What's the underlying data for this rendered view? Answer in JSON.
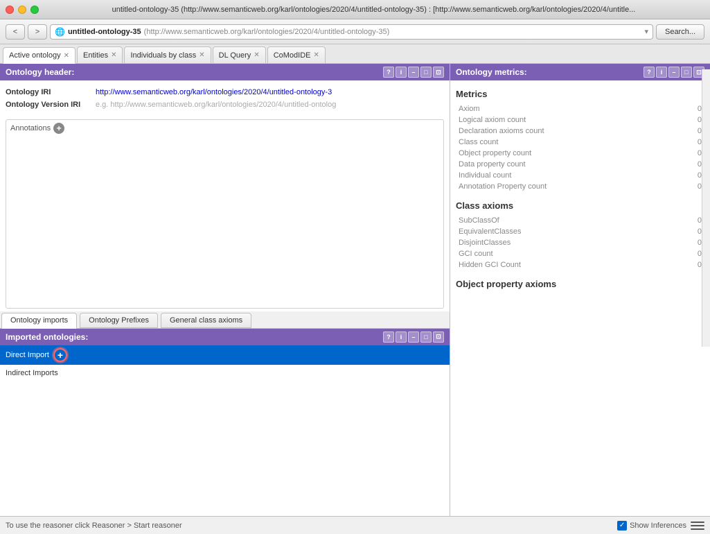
{
  "titlebar": {
    "title": "untitled-ontology-35 (http://www.semanticweb.org/karl/ontologies/2020/4/untitled-ontology-35) : [http://www.semanticweb.org/karl/ontologies/2020/4/untitle..."
  },
  "navbar": {
    "back": "<",
    "forward": ">",
    "url_bold": "untitled-ontology-35",
    "url_light": "(http://www.semanticweb.org/karl/ontologies/2020/4/untitled-ontology-35)",
    "search_placeholder": "Search..."
  },
  "tabs": [
    {
      "label": "Active ontology",
      "closable": true
    },
    {
      "label": "Entities",
      "closable": true
    },
    {
      "label": "Individuals by class",
      "closable": true
    },
    {
      "label": "DL Query",
      "closable": true
    },
    {
      "label": "CoModIDE",
      "closable": true
    }
  ],
  "ontology_header": {
    "title": "Ontology header:",
    "iri_label": "Ontology IRI",
    "iri_value": "http://www.semanticweb.org/karl/ontologies/2020/4/untitled-ontology-3",
    "version_label": "Ontology Version IRI",
    "version_placeholder": "e.g. http://www.semanticweb.org/karl/ontologies/2020/4/untitled-ontolog",
    "annotations_label": "Annotations"
  },
  "bottom_tabs": [
    {
      "label": "Ontology imports",
      "active": true
    },
    {
      "label": "Ontology Prefixes",
      "active": false
    },
    {
      "label": "General class axioms",
      "active": false
    }
  ],
  "imported_ontologies": {
    "title": "Imported ontologies:",
    "direct_import_label": "Direct Import",
    "indirect_imports_label": "Indirect Imports"
  },
  "metrics": {
    "title": "Ontology metrics:",
    "sections": [
      {
        "title": "Metrics",
        "rows": [
          {
            "name": "Axiom",
            "value": "0"
          },
          {
            "name": "Logical axiom count",
            "value": "0"
          },
          {
            "name": "Declaration axioms count",
            "value": "0"
          },
          {
            "name": "Class count",
            "value": "0"
          },
          {
            "name": "Object property count",
            "value": "0"
          },
          {
            "name": "Data property count",
            "value": "0"
          },
          {
            "name": "Individual count",
            "value": "0"
          },
          {
            "name": "Annotation Property count",
            "value": "0"
          }
        ]
      },
      {
        "title": "Class axioms",
        "rows": [
          {
            "name": "SubClassOf",
            "value": "0"
          },
          {
            "name": "EquivalentClasses",
            "value": "0"
          },
          {
            "name": "DisjointClasses",
            "value": "0"
          },
          {
            "name": "GCI count",
            "value": "0"
          },
          {
            "name": "Hidden GCI Count",
            "value": "0"
          }
        ]
      },
      {
        "title": "Object property axioms",
        "rows": []
      }
    ]
  },
  "status_bar": {
    "message": "To use the reasoner click Reasoner > Start reasoner",
    "show_inferences": "Show Inferences"
  },
  "icons": {
    "question": "?",
    "info": "i",
    "minimize": "–",
    "restore": "□",
    "close": "✕",
    "check": "✓",
    "plus": "+"
  }
}
